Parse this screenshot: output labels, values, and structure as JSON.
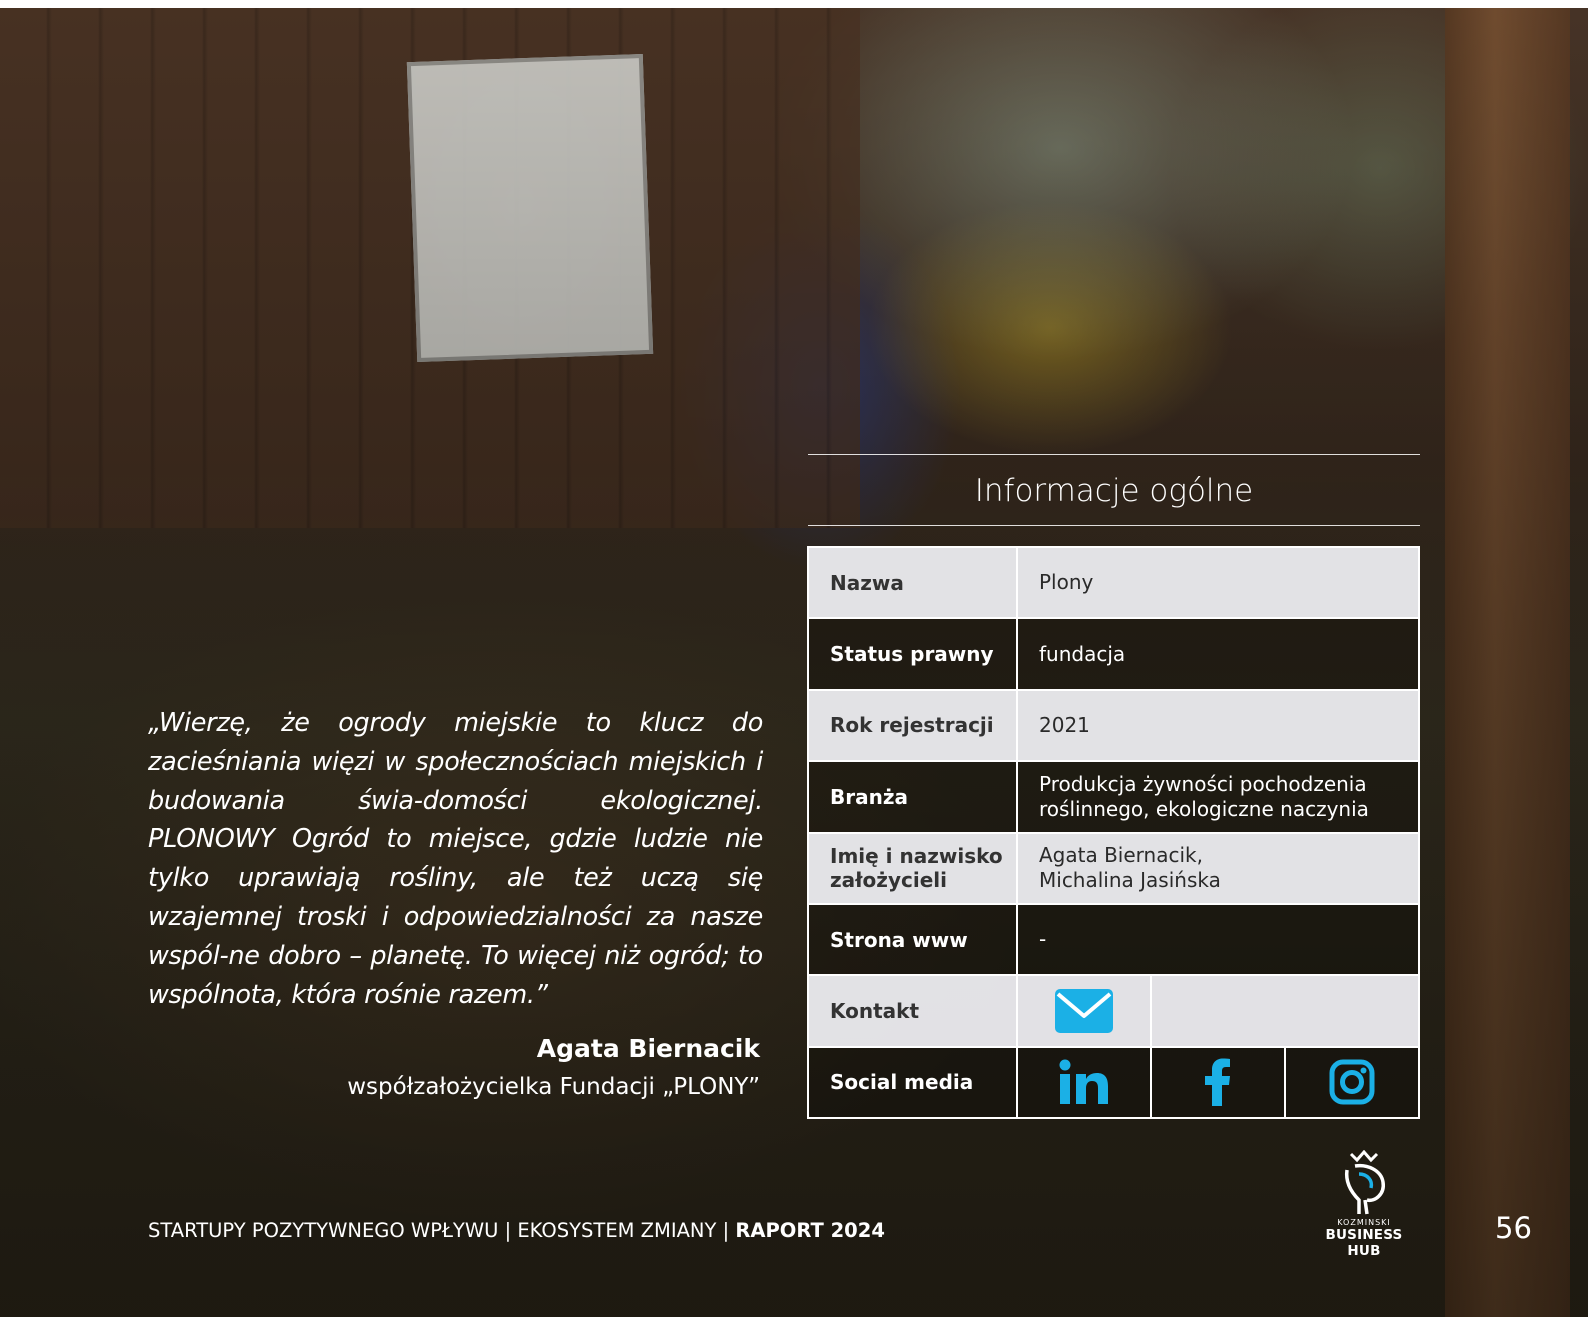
{
  "info": {
    "title": "Informacje ogólne",
    "rows": [
      {
        "label": "Nazwa",
        "value": "Plony"
      },
      {
        "label": "Status prawny",
        "value": "fundacja"
      },
      {
        "label": "Rok rejestracji",
        "value": "2021"
      },
      {
        "label": "Branża",
        "value": "Produkcja żywności pochodzenia roślinnego, ekologiczne naczynia"
      },
      {
        "label": "Imię i nazwisko założycieli",
        "value_line1": "Agata Biernacik,",
        "value_line2": "Michalina Jasińska"
      },
      {
        "label": "Strona www",
        "value": "-"
      },
      {
        "label": "Kontakt"
      },
      {
        "label": "Social media"
      }
    ],
    "icons": {
      "contact": "mail-icon",
      "social": [
        "linkedin-icon",
        "facebook-icon",
        "instagram-icon"
      ],
      "accent": "#1bb0e6"
    }
  },
  "quote": {
    "text": "„Wierzę, że ogrody miejskie to klucz do zacieśniania więzi w społecznościach miejskich i budowania świa-domości ekologicznej. PLONOWY Ogród to miejsce, gdzie ludzie nie tylko uprawiają rośliny, ale też uczą się wzajemnej troski i odpowiedzialności za nasze wspól-ne dobro – planetę. To więcej niż ogród; to wspólnota, która rośnie razem.”",
    "author": "Agata Biernacik",
    "role": "współzałożycielka Fundacji „PLONY”"
  },
  "footer": {
    "left": "STARTUPY POZYTYWNEGO WPŁYWU | EKOSYSTEM ZMIANY | ",
    "bold": "RAPORT 2024",
    "page": "56",
    "logo_small": "KOZMINSKI",
    "logo_big": "BUSINESS HUB"
  }
}
